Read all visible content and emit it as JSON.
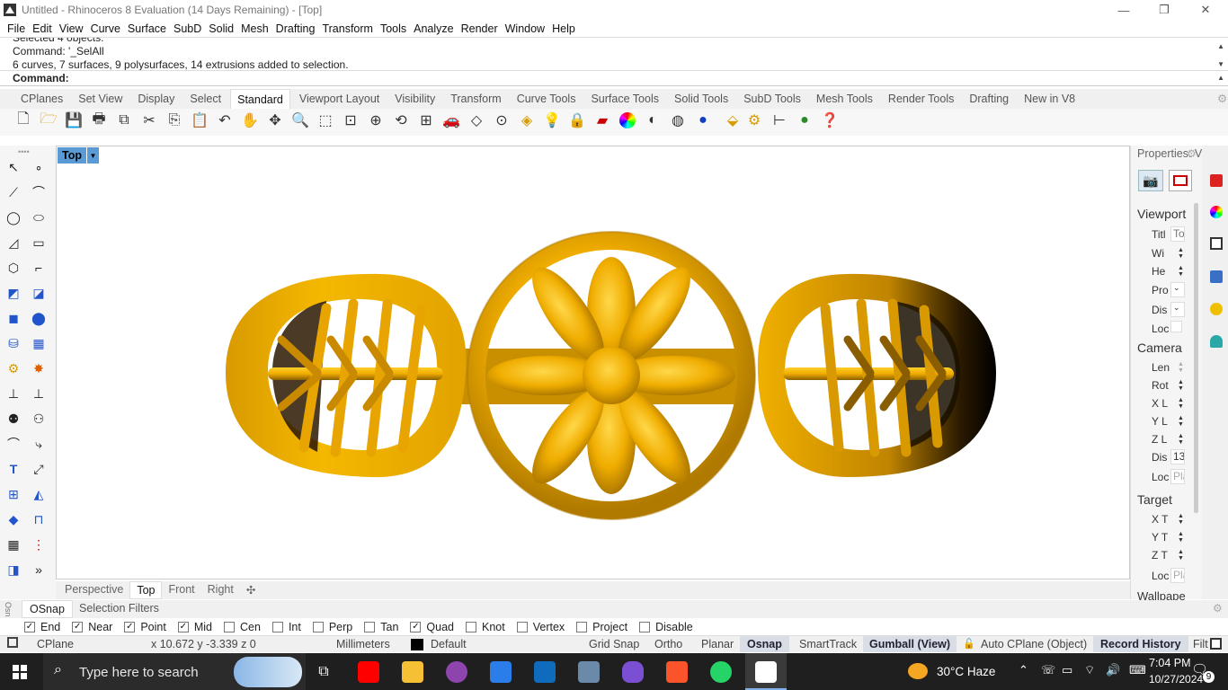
{
  "window": {
    "title": "Untitled - Rhinoceros 8 Evaluation (14 Days Remaining) - [Top]",
    "minimize": "—",
    "maximize": "❐",
    "close": "✕"
  },
  "menu": [
    "File",
    "Edit",
    "View",
    "Curve",
    "Surface",
    "SubD",
    "Solid",
    "Mesh",
    "Drafting",
    "Transform",
    "Tools",
    "Analyze",
    "Render",
    "Window",
    "Help"
  ],
  "command": {
    "history": [
      "Selected 4 objects.",
      "Command: '_SelAll",
      "6 curves, 7 surfaces, 9 polysurfaces, 14 extrusions added to selection."
    ],
    "prompt": "Command:"
  },
  "toolbar_tabs": [
    "CPlanes",
    "Set View",
    "Display",
    "Select",
    "Standard",
    "Viewport Layout",
    "Visibility",
    "Transform",
    "Curve Tools",
    "Surface Tools",
    "Solid Tools",
    "SubD Tools",
    "Mesh Tools",
    "Render Tools",
    "Drafting",
    "New in V8"
  ],
  "active_toolbar_tab": "Standard",
  "viewport": {
    "name": "Top",
    "tabs": [
      "Perspective",
      "Top",
      "Front",
      "Right"
    ],
    "active_tab": "Top",
    "add_tab": "✣"
  },
  "properties": {
    "title": "Properties: Vi...",
    "sections": {
      "viewport": "Viewport",
      "camera": "Camera",
      "target": "Target",
      "wallpaper": "Wallpape"
    },
    "viewport_rows": [
      {
        "label": "Titl",
        "value": "To"
      },
      {
        "label": "Wi",
        "value": ""
      },
      {
        "label": "He",
        "value": ""
      },
      {
        "label": "Pro",
        "value": ""
      },
      {
        "label": "Dis",
        "value": ""
      },
      {
        "label": "Loc",
        "value": ""
      }
    ],
    "camera_rows": [
      {
        "label": "Len",
        "value": ""
      },
      {
        "label": "Rot",
        "value": ""
      },
      {
        "label": "X L",
        "value": ""
      },
      {
        "label": "Y L",
        "value": ""
      },
      {
        "label": "Z L",
        "value": ""
      },
      {
        "label": "Dis",
        "value": "13"
      },
      {
        "label": "Loc",
        "value": "Pla"
      }
    ],
    "target_rows": [
      {
        "label": "X T",
        "value": ""
      },
      {
        "label": "Y T",
        "value": ""
      },
      {
        "label": "Z T",
        "value": ""
      },
      {
        "label": "Loc",
        "value": "Pla"
      }
    ]
  },
  "osnap": {
    "tabs": [
      "OSnap",
      "Selection Filters"
    ],
    "items": [
      {
        "label": "End",
        "checked": true
      },
      {
        "label": "Near",
        "checked": true
      },
      {
        "label": "Point",
        "checked": true
      },
      {
        "label": "Mid",
        "checked": true
      },
      {
        "label": "Cen",
        "checked": false
      },
      {
        "label": "Int",
        "checked": false
      },
      {
        "label": "Perp",
        "checked": false
      },
      {
        "label": "Tan",
        "checked": false
      },
      {
        "label": "Quad",
        "checked": true
      },
      {
        "label": "Knot",
        "checked": false
      },
      {
        "label": "Vertex",
        "checked": false
      },
      {
        "label": "Project",
        "checked": false
      },
      {
        "label": "Disable",
        "checked": false
      }
    ]
  },
  "status": {
    "cplane": "CPlane",
    "coords": "x 10.672  y -3.339  z 0",
    "units": "Millimeters",
    "layer": "Default",
    "grid_snap": "Grid Snap",
    "ortho": "Ortho",
    "planar": "Planar",
    "osnap": "Osnap",
    "smarttrack": "SmartTrack",
    "gumball": "Gumball (View)",
    "auto_cplane": "Auto CPlane (Object)",
    "record_history": "Record History",
    "filter": "Filt"
  },
  "taskbar": {
    "search_placeholder": "Type here to search",
    "weather": "30°C  Haze",
    "time": "7:04 PM",
    "date": "10/27/2024",
    "notifications": "9",
    "rhino_badge": "8"
  },
  "colors": {
    "gold": "#f2b100",
    "gold_dark": "#7a5400",
    "viewport_tab_blue": "#5b9bd5",
    "taskbar": "#1f1f1f"
  }
}
